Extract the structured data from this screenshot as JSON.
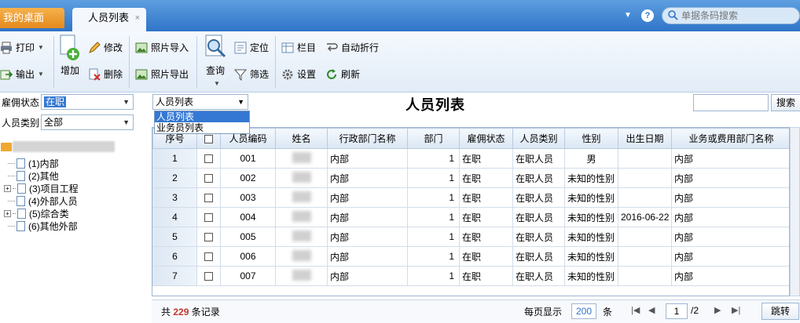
{
  "tabs": {
    "home": "我的桌面",
    "active": "人员列表",
    "close": "×"
  },
  "header": {
    "help": "?",
    "search_placeholder": "单据条码搜索"
  },
  "toolbar": {
    "print": "打印",
    "export": "输出",
    "add": "增加",
    "edit": "修改",
    "delete": "删除",
    "photo_import": "照片导入",
    "photo_export": "照片导出",
    "query": "查询",
    "locate": "定位",
    "filter": "筛选",
    "columns": "栏目",
    "settings": "设置",
    "auto_wrap": "自动折行",
    "refresh": "刷新"
  },
  "left": {
    "employment_status_label": "雇佣状态",
    "employment_status_value": "在职",
    "person_type_label": "人员类别",
    "person_type_value": "全部",
    "tree": [
      {
        "label": "(1)内部",
        "expandable": false
      },
      {
        "label": "(2)其他",
        "expandable": false
      },
      {
        "label": "(3)项目工程",
        "expandable": true
      },
      {
        "label": "(4)外部人员",
        "expandable": false
      },
      {
        "label": "(5)综合类",
        "expandable": true
      },
      {
        "label": "(6)其他外部",
        "expandable": false
      }
    ]
  },
  "main": {
    "view_selected": "人员列表",
    "view_options": [
      "人员列表",
      "业务员列表"
    ],
    "title": "人员列表",
    "search_button": "搜索"
  },
  "grid": {
    "columns": [
      "序号",
      "",
      "人员编码",
      "姓名",
      "行政部门名称",
      "部门",
      "雇佣状态",
      "人员类别",
      "性别",
      "出生日期",
      "业务或费用部门名称"
    ],
    "rows": [
      {
        "no": "1",
        "code": "001",
        "dept_name": "内部",
        "dept": "1",
        "status": "在职",
        "type": "在职人员",
        "gender": "男",
        "birth": "",
        "biz_dept": "内部"
      },
      {
        "no": "2",
        "code": "002",
        "dept_name": "内部",
        "dept": "1",
        "status": "在职",
        "type": "在职人员",
        "gender": "未知的性别",
        "birth": "",
        "biz_dept": "内部"
      },
      {
        "no": "3",
        "code": "003",
        "dept_name": "内部",
        "dept": "1",
        "status": "在职",
        "type": "在职人员",
        "gender": "未知的性别",
        "birth": "",
        "biz_dept": "内部"
      },
      {
        "no": "4",
        "code": "004",
        "dept_name": "内部",
        "dept": "1",
        "status": "在职",
        "type": "在职人员",
        "gender": "未知的性别",
        "birth": "2016-06-22",
        "biz_dept": "内部"
      },
      {
        "no": "5",
        "code": "005",
        "dept_name": "内部",
        "dept": "1",
        "status": "在职",
        "type": "在职人员",
        "gender": "未知的性别",
        "birth": "",
        "biz_dept": "内部"
      },
      {
        "no": "6",
        "code": "006",
        "dept_name": "内部",
        "dept": "1",
        "status": "在职",
        "type": "在职人员",
        "gender": "未知的性别",
        "birth": "",
        "biz_dept": "内部"
      },
      {
        "no": "7",
        "code": "007",
        "dept_name": "内部",
        "dept": "1",
        "status": "在职",
        "type": "在职人员",
        "gender": "未知的性别",
        "birth": "",
        "biz_dept": "内部"
      }
    ]
  },
  "pager": {
    "total_prefix": "共",
    "total_count": "229",
    "total_suffix": "条记录",
    "per_page_label": "每页显示",
    "per_page_value": "200",
    "per_page_unit": "条",
    "current_page": "1",
    "total_pages": "/2",
    "go_button": "跳转"
  },
  "colors": {
    "tab_bar": "#2f74c8",
    "home_tab": "#e4891b",
    "total_count": "#c0392b"
  }
}
